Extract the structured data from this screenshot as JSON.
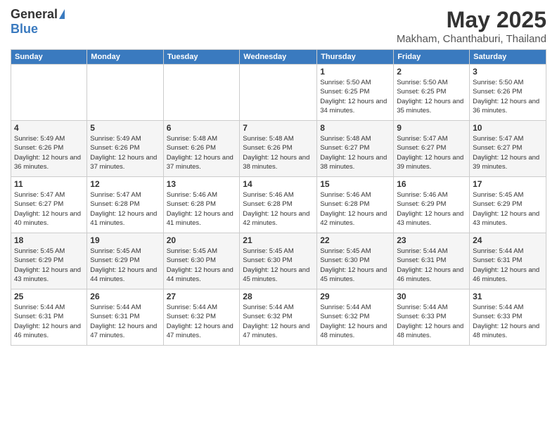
{
  "logo": {
    "general": "General",
    "blue": "Blue"
  },
  "header": {
    "title": "May 2025",
    "subtitle": "Makham, Chanthaburi, Thailand"
  },
  "days_of_week": [
    "Sunday",
    "Monday",
    "Tuesday",
    "Wednesday",
    "Thursday",
    "Friday",
    "Saturday"
  ],
  "weeks": [
    [
      {
        "day": "",
        "info": ""
      },
      {
        "day": "",
        "info": ""
      },
      {
        "day": "",
        "info": ""
      },
      {
        "day": "",
        "info": ""
      },
      {
        "day": "1",
        "info": "Sunrise: 5:50 AM\nSunset: 6:25 PM\nDaylight: 12 hours and 34 minutes."
      },
      {
        "day": "2",
        "info": "Sunrise: 5:50 AM\nSunset: 6:25 PM\nDaylight: 12 hours and 35 minutes."
      },
      {
        "day": "3",
        "info": "Sunrise: 5:50 AM\nSunset: 6:26 PM\nDaylight: 12 hours and 36 minutes."
      }
    ],
    [
      {
        "day": "4",
        "info": "Sunrise: 5:49 AM\nSunset: 6:26 PM\nDaylight: 12 hours and 36 minutes."
      },
      {
        "day": "5",
        "info": "Sunrise: 5:49 AM\nSunset: 6:26 PM\nDaylight: 12 hours and 37 minutes."
      },
      {
        "day": "6",
        "info": "Sunrise: 5:48 AM\nSunset: 6:26 PM\nDaylight: 12 hours and 37 minutes."
      },
      {
        "day": "7",
        "info": "Sunrise: 5:48 AM\nSunset: 6:26 PM\nDaylight: 12 hours and 38 minutes."
      },
      {
        "day": "8",
        "info": "Sunrise: 5:48 AM\nSunset: 6:27 PM\nDaylight: 12 hours and 38 minutes."
      },
      {
        "day": "9",
        "info": "Sunrise: 5:47 AM\nSunset: 6:27 PM\nDaylight: 12 hours and 39 minutes."
      },
      {
        "day": "10",
        "info": "Sunrise: 5:47 AM\nSunset: 6:27 PM\nDaylight: 12 hours and 39 minutes."
      }
    ],
    [
      {
        "day": "11",
        "info": "Sunrise: 5:47 AM\nSunset: 6:27 PM\nDaylight: 12 hours and 40 minutes."
      },
      {
        "day": "12",
        "info": "Sunrise: 5:47 AM\nSunset: 6:28 PM\nDaylight: 12 hours and 41 minutes."
      },
      {
        "day": "13",
        "info": "Sunrise: 5:46 AM\nSunset: 6:28 PM\nDaylight: 12 hours and 41 minutes."
      },
      {
        "day": "14",
        "info": "Sunrise: 5:46 AM\nSunset: 6:28 PM\nDaylight: 12 hours and 42 minutes."
      },
      {
        "day": "15",
        "info": "Sunrise: 5:46 AM\nSunset: 6:28 PM\nDaylight: 12 hours and 42 minutes."
      },
      {
        "day": "16",
        "info": "Sunrise: 5:46 AM\nSunset: 6:29 PM\nDaylight: 12 hours and 43 minutes."
      },
      {
        "day": "17",
        "info": "Sunrise: 5:45 AM\nSunset: 6:29 PM\nDaylight: 12 hours and 43 minutes."
      }
    ],
    [
      {
        "day": "18",
        "info": "Sunrise: 5:45 AM\nSunset: 6:29 PM\nDaylight: 12 hours and 43 minutes."
      },
      {
        "day": "19",
        "info": "Sunrise: 5:45 AM\nSunset: 6:29 PM\nDaylight: 12 hours and 44 minutes."
      },
      {
        "day": "20",
        "info": "Sunrise: 5:45 AM\nSunset: 6:30 PM\nDaylight: 12 hours and 44 minutes."
      },
      {
        "day": "21",
        "info": "Sunrise: 5:45 AM\nSunset: 6:30 PM\nDaylight: 12 hours and 45 minutes."
      },
      {
        "day": "22",
        "info": "Sunrise: 5:45 AM\nSunset: 6:30 PM\nDaylight: 12 hours and 45 minutes."
      },
      {
        "day": "23",
        "info": "Sunrise: 5:44 AM\nSunset: 6:31 PM\nDaylight: 12 hours and 46 minutes."
      },
      {
        "day": "24",
        "info": "Sunrise: 5:44 AM\nSunset: 6:31 PM\nDaylight: 12 hours and 46 minutes."
      }
    ],
    [
      {
        "day": "25",
        "info": "Sunrise: 5:44 AM\nSunset: 6:31 PM\nDaylight: 12 hours and 46 minutes."
      },
      {
        "day": "26",
        "info": "Sunrise: 5:44 AM\nSunset: 6:31 PM\nDaylight: 12 hours and 47 minutes."
      },
      {
        "day": "27",
        "info": "Sunrise: 5:44 AM\nSunset: 6:32 PM\nDaylight: 12 hours and 47 minutes."
      },
      {
        "day": "28",
        "info": "Sunrise: 5:44 AM\nSunset: 6:32 PM\nDaylight: 12 hours and 47 minutes."
      },
      {
        "day": "29",
        "info": "Sunrise: 5:44 AM\nSunset: 6:32 PM\nDaylight: 12 hours and 48 minutes."
      },
      {
        "day": "30",
        "info": "Sunrise: 5:44 AM\nSunset: 6:33 PM\nDaylight: 12 hours and 48 minutes."
      },
      {
        "day": "31",
        "info": "Sunrise: 5:44 AM\nSunset: 6:33 PM\nDaylight: 12 hours and 48 minutes."
      }
    ]
  ]
}
